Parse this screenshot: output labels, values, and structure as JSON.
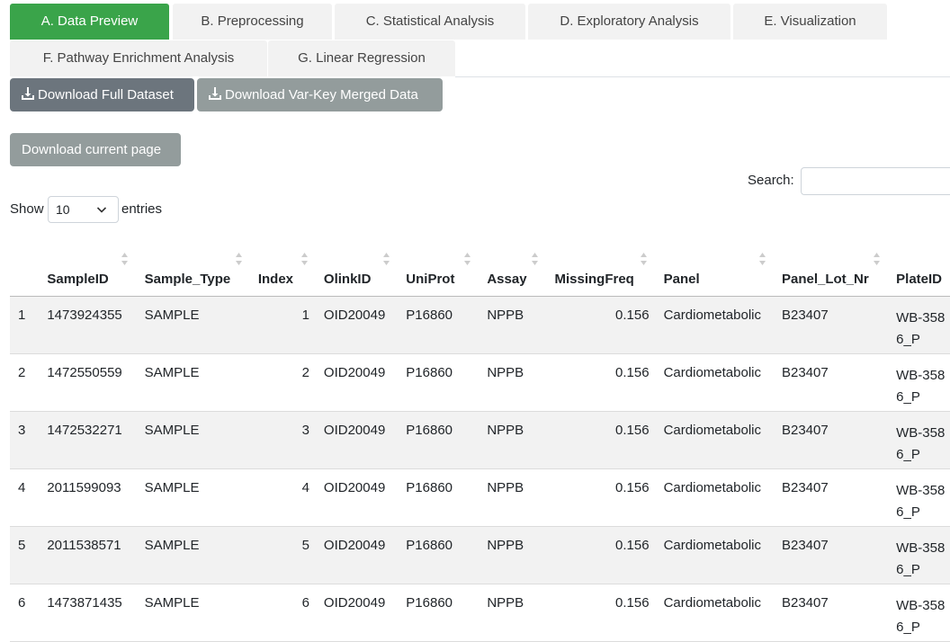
{
  "tabs": [
    {
      "label": "A. Data Preview",
      "active": true
    },
    {
      "label": "B. Preprocessing",
      "active": false
    },
    {
      "label": "C. Statistical Analysis",
      "active": false
    },
    {
      "label": "D. Exploratory Analysis",
      "active": false
    },
    {
      "label": "E. Visualization",
      "active": false
    },
    {
      "label": "F. Pathway Enrichment Analysis",
      "active": false
    },
    {
      "label": "G. Linear Regression",
      "active": false
    }
  ],
  "buttons": {
    "download_full": "Download Full Dataset",
    "download_merged": "Download Var-Key Merged Data",
    "download_page": "Download current page"
  },
  "search": {
    "label": "Search:",
    "value": ""
  },
  "length": {
    "show": "Show",
    "value": "10",
    "entries": "entries"
  },
  "table": {
    "columns": [
      "",
      "SampleID",
      "Sample_Type",
      "Index",
      "OlinkID",
      "UniProt",
      "Assay",
      "MissingFreq",
      "Panel",
      "Panel_Lot_Nr",
      "PlateID"
    ],
    "rows": [
      {
        "n": "1",
        "SampleID": "1473924355",
        "Sample_Type": "SAMPLE",
        "Index": "1",
        "OlinkID": "OID20049",
        "UniProt": "P16860",
        "Assay": "NPPB",
        "MissingFreq": "0.156",
        "Panel": "Cardiometabolic",
        "Panel_Lot_Nr": "B23407",
        "PlateID": "WB-3586_P"
      },
      {
        "n": "2",
        "SampleID": "1472550559",
        "Sample_Type": "SAMPLE",
        "Index": "2",
        "OlinkID": "OID20049",
        "UniProt": "P16860",
        "Assay": "NPPB",
        "MissingFreq": "0.156",
        "Panel": "Cardiometabolic",
        "Panel_Lot_Nr": "B23407",
        "PlateID": "WB-3586_P"
      },
      {
        "n": "3",
        "SampleID": "1472532271",
        "Sample_Type": "SAMPLE",
        "Index": "3",
        "OlinkID": "OID20049",
        "UniProt": "P16860",
        "Assay": "NPPB",
        "MissingFreq": "0.156",
        "Panel": "Cardiometabolic",
        "Panel_Lot_Nr": "B23407",
        "PlateID": "WB-3586_P"
      },
      {
        "n": "4",
        "SampleID": "2011599093",
        "Sample_Type": "SAMPLE",
        "Index": "4",
        "OlinkID": "OID20049",
        "UniProt": "P16860",
        "Assay": "NPPB",
        "MissingFreq": "0.156",
        "Panel": "Cardiometabolic",
        "Panel_Lot_Nr": "B23407",
        "PlateID": "WB-3586_P"
      },
      {
        "n": "5",
        "SampleID": "2011538571",
        "Sample_Type": "SAMPLE",
        "Index": "5",
        "OlinkID": "OID20049",
        "UniProt": "P16860",
        "Assay": "NPPB",
        "MissingFreq": "0.156",
        "Panel": "Cardiometabolic",
        "Panel_Lot_Nr": "B23407",
        "PlateID": "WB-3586_P"
      },
      {
        "n": "6",
        "SampleID": "1473871435",
        "Sample_Type": "SAMPLE",
        "Index": "6",
        "OlinkID": "OID20049",
        "UniProt": "P16860",
        "Assay": "NPPB",
        "MissingFreq": "0.156",
        "Panel": "Cardiometabolic",
        "Panel_Lot_Nr": "B23407",
        "PlateID": "WB-3586_P"
      }
    ]
  },
  "colors": {
    "active_tab": "#3aa44a",
    "button_dark": "#6c757d",
    "button_light": "#939c9c",
    "row_stripe": "#f2f2f2"
  },
  "icons": {
    "download": "download-icon",
    "sort": "sort-icon",
    "select": "chevron-down-icon"
  }
}
